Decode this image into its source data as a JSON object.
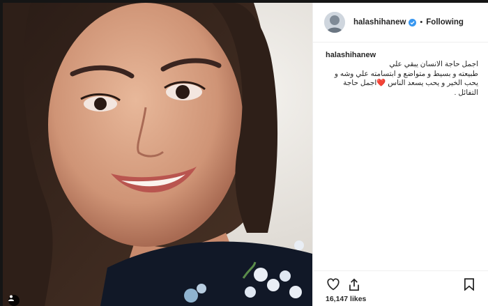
{
  "post": {
    "username": "halashihanew",
    "follow_status": "Following",
    "separator": "•",
    "caption_user": "halashihanew",
    "caption_text": "اجمل حاجة الانسان يبقي علي\nطبيعته و بسيط و متواضع و ابتسامته علي وشه و\nيحب الخير و يحب يسعد الناس ❤️اجمل حاجة\nالتفائل .",
    "likes": "16,147 likes"
  },
  "icons": {
    "verified": "verified-badge-icon",
    "like": "heart-outline-icon",
    "share": "share-icon",
    "save": "bookmark-icon",
    "tag": "person-tag-icon"
  },
  "colors": {
    "verified_blue": "#3897f0",
    "text": "#262626",
    "border": "#efefef"
  }
}
